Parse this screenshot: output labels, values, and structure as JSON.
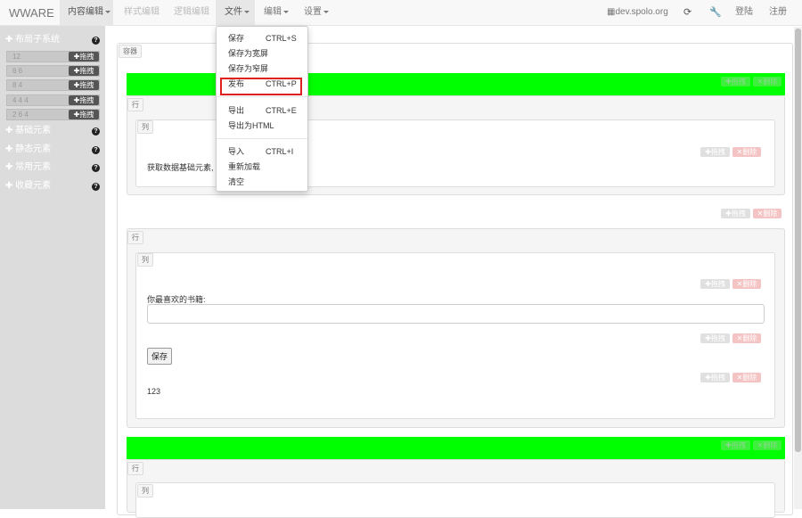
{
  "navbar": {
    "brand": "WWARE",
    "content_edit": "内容编辑",
    "style_edit": "样式编辑",
    "logic_edit": "逻辑编辑",
    "file": "文件",
    "edit": "编辑",
    "settings": "设置",
    "site": "dev.spolo.org",
    "login": "登陆",
    "register": "注册"
  },
  "sidebar": {
    "layout_header": "布局子系统",
    "layout_rows": [
      "12",
      "6 6",
      "8 4",
      "4 4 4",
      "2 6 4"
    ],
    "drag_label": "拖拽",
    "sections": [
      "基础元素",
      "静态元素",
      "常用元素",
      "收藏元素"
    ]
  },
  "file_menu": {
    "items": [
      {
        "label": "保存",
        "shortcut": "CTRL+S"
      },
      {
        "label": "保存为宽屏",
        "shortcut": ""
      },
      {
        "label": "保存为窄屏",
        "shortcut": ""
      },
      {
        "label": "发布",
        "shortcut": "CTRL+P"
      },
      {
        "label": "导出",
        "shortcut": "CTRL+E"
      },
      {
        "label": "导出为HTML",
        "shortcut": ""
      },
      {
        "label": "导入",
        "shortcut": "CTRL+I"
      },
      {
        "label": "重新加载",
        "shortcut": ""
      },
      {
        "label": "清空",
        "shortcut": ""
      }
    ]
  },
  "canvas": {
    "container_tag": "容器",
    "row_tag": "行",
    "col_tag": "列",
    "drag_label": "拖拽",
    "delete_label": "删除",
    "block1_text": "获取数据基础元素,",
    "book_label": "你最喜欢的书籍:",
    "save_button": "保存",
    "number_text": "123"
  },
  "colors": {
    "accent_green": "#00ff00",
    "highlight_red": "#e02020"
  }
}
